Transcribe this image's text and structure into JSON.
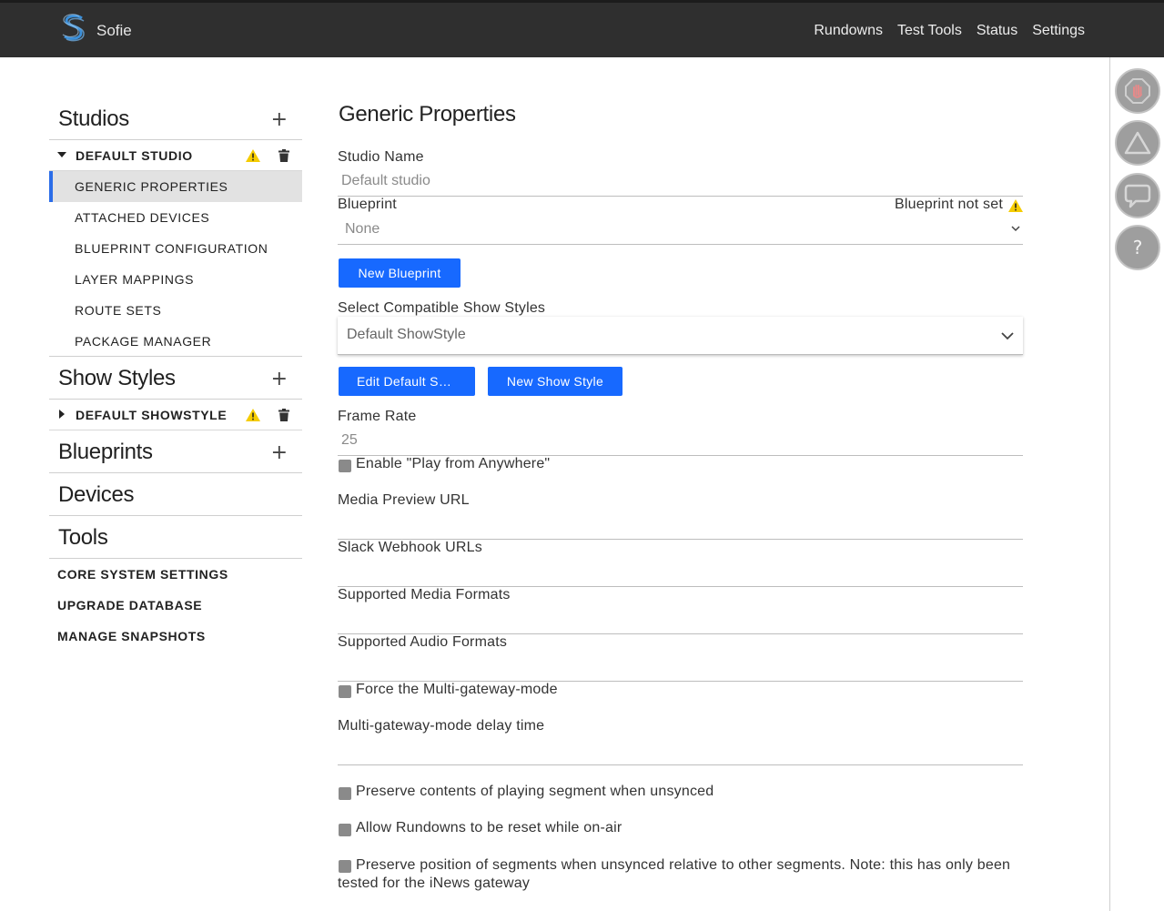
{
  "header": {
    "brand": "Sofie",
    "nav": [
      "Rundowns",
      "Test Tools",
      "Status",
      "Settings"
    ]
  },
  "sidebar": {
    "studios": {
      "title": "Studios",
      "studio_name": "DEFAULT STUDIO",
      "items": [
        "GENERIC PROPERTIES",
        "ATTACHED DEVICES",
        "BLUEPRINT CONFIGURATION",
        "LAYER MAPPINGS",
        "ROUTE SETS",
        "PACKAGE MANAGER"
      ]
    },
    "show_styles": {
      "title": "Show Styles",
      "name": "DEFAULT SHOWSTYLE"
    },
    "blueprints": {
      "title": "Blueprints"
    },
    "devices": {
      "title": "Devices"
    },
    "tools": {
      "title": "Tools",
      "items": [
        "CORE SYSTEM SETTINGS",
        "UPGRADE DATABASE",
        "MANAGE SNAPSHOTS"
      ]
    }
  },
  "form": {
    "title": "Generic Properties",
    "studio_name_label": "Studio Name",
    "studio_name_value": "Default studio",
    "blueprint_label": "Blueprint",
    "blueprint_warning": "Blueprint not set",
    "blueprint_value": "None",
    "new_blueprint_button": "New Blueprint",
    "show_styles_label": "Select Compatible Show Styles",
    "show_styles_value": "Default ShowStyle",
    "edit_default_button": "Edit Default Sh…",
    "new_show_style_button": "New Show Style",
    "frame_rate_label": "Frame Rate",
    "frame_rate_value": "25",
    "play_anywhere_label": "Enable \"Play from Anywhere\"",
    "media_preview_label": "Media Preview URL",
    "slack_webhook_label": "Slack Webhook URLs",
    "media_formats_label": "Supported Media Formats",
    "audio_formats_label": "Supported Audio Formats",
    "force_multigateway_label": "Force the Multi-gateway-mode",
    "multigateway_delay_label": "Multi-gateway-mode delay time",
    "preserve_playing_label": "Preserve contents of playing segment when unsynced",
    "allow_reset_label": "Allow Rundowns to be reset while on-air",
    "preserve_position_label": "Preserve position of segments when unsynced relative to other segments. Note: this has only been tested for the iNews gateway"
  },
  "icons": {
    "logo": "sofie-logo-icon",
    "rail": [
      "stop-hand-icon",
      "warning-triangle-icon",
      "speech-bubble-icon",
      "help-icon"
    ],
    "help_glyph": "?"
  },
  "colors": {
    "accent": "#1769ff",
    "warning": "#f5cc00",
    "header_bg": "#2f2f2f"
  }
}
